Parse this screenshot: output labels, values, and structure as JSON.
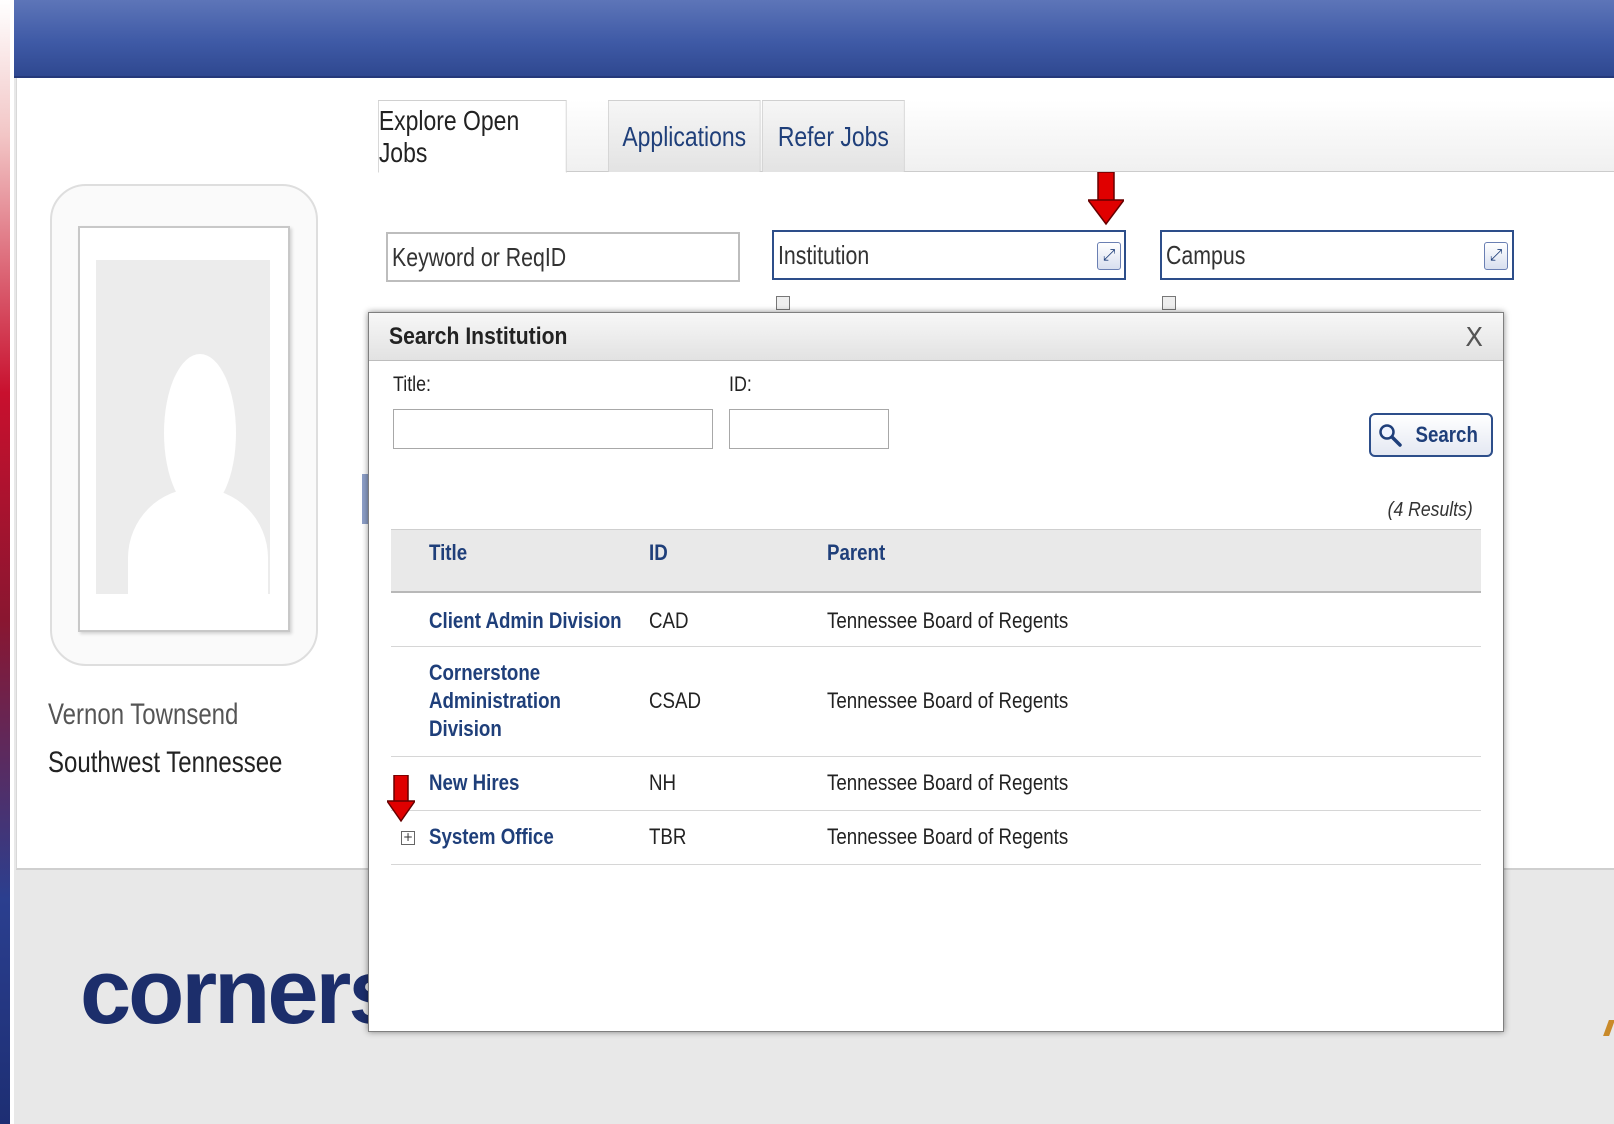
{
  "tabs": [
    {
      "label": "Explore Open Jobs",
      "active": true
    },
    {
      "label": "Applications",
      "active": false
    },
    {
      "label": "Refer Jobs",
      "active": false
    }
  ],
  "search": {
    "keyword_placeholder": "Keyword or ReqID",
    "institution_value": "Institution",
    "campus_value": "Campus"
  },
  "profile": {
    "name": "Vernon Townsend",
    "organization": "Southwest Tennessee"
  },
  "logo": {
    "text": "cornerstone"
  },
  "dialog": {
    "title": "Search Institution",
    "close_label": "X",
    "title_label": "Title:",
    "id_label": "ID:",
    "search_button": "Search",
    "results_count": "(4 Results)",
    "columns": [
      "Title",
      "ID",
      "Parent"
    ],
    "rows": [
      {
        "title": "Client Admin Division",
        "id": "CAD",
        "parent": "Tennessee Board of Regents",
        "expandable": false
      },
      {
        "title": "Cornerstone Administration Division",
        "id": "CSAD",
        "parent": "Tennessee Board of Regents",
        "expandable": false
      },
      {
        "title": "New Hires",
        "id": "NH",
        "parent": "Tennessee Board of Regents",
        "expandable": false
      },
      {
        "title": "System Office",
        "id": "TBR",
        "parent": "Tennessee Board of Regents",
        "expandable": true
      }
    ]
  },
  "colors": {
    "header_blue": "#3f5aa6",
    "link_blue": "#1f3f7a",
    "annotation_red": "#e00000"
  },
  "icons": {
    "lookup": "lookup-icon",
    "search": "magnifier-icon",
    "expand": "plus-box-icon",
    "annotation": "red-down-arrow-icon"
  }
}
